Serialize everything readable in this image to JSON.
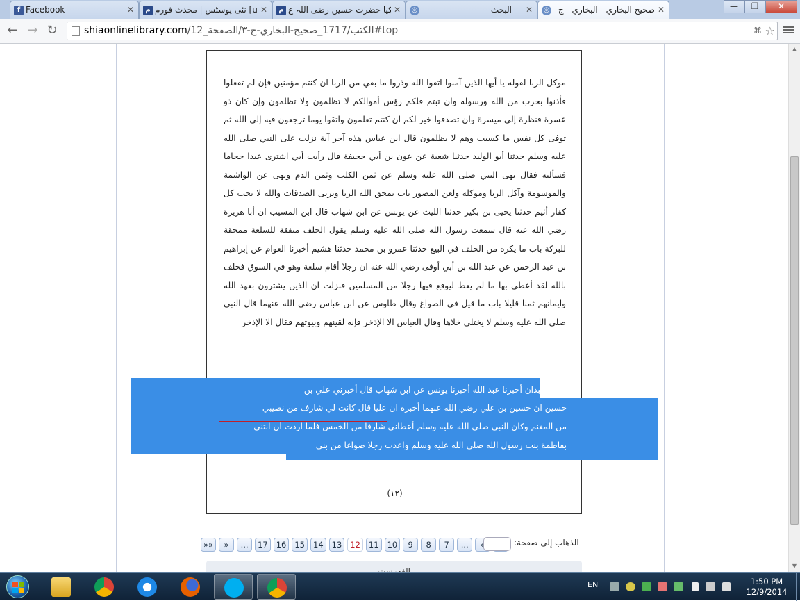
{
  "browser": {
    "tabs": [
      {
        "title": "Facebook",
        "icon": "facebook-icon",
        "active": false
      },
      {
        "title": "نئی پوسٹس | محدث فورم [um",
        "icon": "forum-icon",
        "active": false
      },
      {
        "title": "کیا حضرت حسین رضی اللہ ع",
        "icon": "forum-icon",
        "active": false
      },
      {
        "title": "البحث",
        "icon": "globe-icon",
        "active": false
      },
      {
        "title": "صحيح البخاري - البخاري - ج",
        "icon": "globe-icon",
        "active": true
      }
    ],
    "window_controls": {
      "minimize": "—",
      "restore": "❐",
      "close": "✕"
    },
    "url_host": "shiaonlinelibrary.com",
    "url_rest": "/الكتب/1717_صحيح-البخاري-ج-٣/الصفحة_12#top"
  },
  "page": {
    "paragraph": "موكل الربا لقوله يا أيها الذين آمنوا اتقوا الله وذروا ما بقي من الربا ان كنتم مؤمنين فإن لم تفعلوا فأذنوا بحرب من الله ورسوله وان تبتم فلكم رؤس أموالكم لا تظلمون ولا تظلمون وإن كان ذو عسرة فنظرة إلى ميسرة وان تصدقوا خير لكم ان كنتم تعلمون واتقوا يوما ترجعون فيه إلى الله ثم توفى كل نفس ما كسبت وهم لا يظلمون قال ابن عباس هذه آخر آية نزلت على النبي صلى الله عليه وسلم حدثنا أبو الوليد حدثنا شعبة عن عون بن أبي جحيفة قال رأيت أبي اشترى عبدا حجاما فسألته فقال نهى النبي صلى الله عليه وسلم عن ثمن الكلب وثمن الدم ونهى عن الواشمة والموشومة وآكل الربا وموكله ولعن المصور باب يمحق الله الربا ويربى الصدقات والله لا يحب كل كفار أثيم حدثنا يحيى بن بكير حدثنا الليث عن يونس عن ابن شهاب قال ابن المسيب ان أبا هريرة رضي الله عنه قال سمعت رسول الله صلى الله عليه وسلم يقول الحلف منفقة للسلعة ممحقة للبركة باب ما يكره من الحلف في البيع حدثنا عمرو بن محمد حدثنا هشيم أخبرنا العوام عن إبراهيم بن عبد الرحمن عن عبد الله بن أبي أوفى رضي الله عنه ان رجلا أقام سلعة وهو في السوق فحلف بالله لقد أعطى بها ما لم يعط ليوقع فيها رجلا من المسلمين فنزلت ان الذين يشترون بعهد الله وايمانهم ثمنا قليلا باب ما قيل في الصواغ وقال طاوس عن ابن عباس رضي الله عنهما قال النبي صلى الله عليه وسلم لا يختلى خلاها وقال العباس الا الإذخر فإنه لقينهم وبيوتهم فقال الا الإذخر",
    "selected_lines": [
      "حدثنا عبدان أخبرنا عبد الله أخبرنا يونس عن ابن شهاب قال أخبرني علي بن",
      "حسين ان حسين بن علي رضي الله عنهما أخبره ان عليا قال كانت لي شارف من نصيبي",
      "من المغنم وكان النبي صلى الله عليه وسلم أعطاني شارفا من الخمس فلما أردت أن ابتنى",
      "بفاطمة بنت رسول الله صلى الله عليه وسلم واعدت رجلا صواغا من بنى"
    ],
    "page_number": "(١٢)"
  },
  "pager": {
    "buttons": [
      "»»",
      "»",
      "...",
      "17",
      "16",
      "15",
      "14",
      "13",
      "12",
      "11",
      "10",
      "9",
      "8",
      "7",
      "...",
      "«",
      "««"
    ],
    "current": "12",
    "goto_label": "الذهاب إلى صفحة:",
    "bottom_label": "الفهرست"
  },
  "taskbar": {
    "apps": [
      "explorer",
      "chrome",
      "internet-explorer",
      "firefox",
      "skype",
      "chrome-active"
    ],
    "language": "EN",
    "time": "1:50 PM",
    "date": "12/9/2014"
  }
}
